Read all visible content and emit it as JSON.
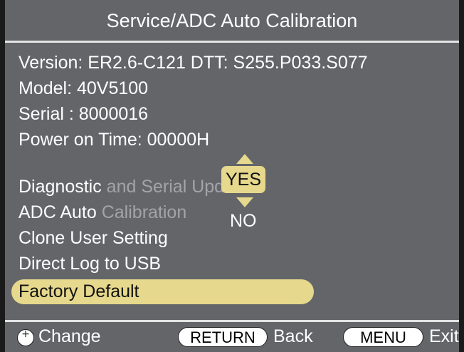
{
  "header": {
    "title": "Service/ADC Auto Calibration"
  },
  "info": {
    "version": "Version: ER2.6-C121  DTT: S255.P033.S077",
    "model": "Model: 40V5100",
    "serial": "Serial :  8000016",
    "power_on_time": "Power on Time: 00000H"
  },
  "menu": {
    "items": [
      {
        "label_main": "Diagnostic",
        "label_dim": " and Serial Update"
      },
      {
        "label_main": "ADC Auto",
        "label_dim": " Calibration"
      },
      {
        "label_main": "Clone User Setting",
        "label_dim": ""
      },
      {
        "label_main": "Direct Log to USB",
        "label_dim": ""
      },
      {
        "label_main": "Factory Default",
        "label_dim": ""
      }
    ],
    "selected_index": 4
  },
  "popup": {
    "yes_label": "YES",
    "no_label": "NO"
  },
  "footer": {
    "change_label": "Change",
    "return_button": "RETURN",
    "back_label": "Back",
    "menu_button": "MENU",
    "exit_label": "Exit"
  },
  "colors": {
    "background": "#636569",
    "highlight": "#e6d88c",
    "dim_text": "#a2a4a9"
  }
}
